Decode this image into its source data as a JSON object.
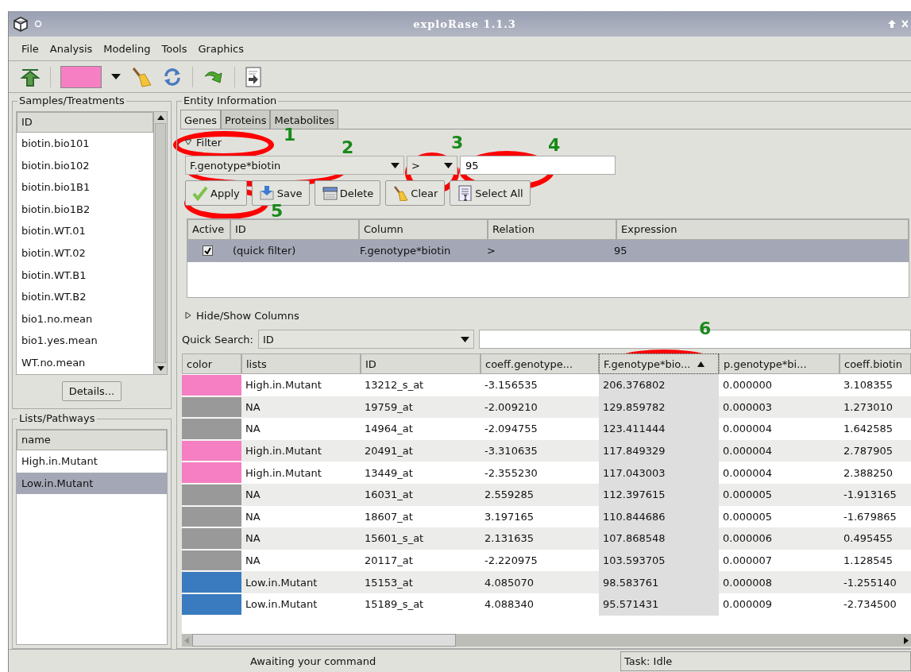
{
  "window": {
    "title": "exploRase 1.1.3"
  },
  "menu": [
    "File",
    "Analysis",
    "Modeling",
    "Tools",
    "Graphics"
  ],
  "samples": {
    "title": "Samples/Treatments",
    "header": "ID",
    "items": [
      "biotin.bio101",
      "biotin.bio102",
      "biotin.bio1B1",
      "biotin.bio1B2",
      "biotin.WT.01",
      "biotin.WT.02",
      "biotin.WT.B1",
      "biotin.WT.B2",
      "bio1.no.mean",
      "bio1.yes.mean",
      "WT.no.mean"
    ],
    "details_button": "Details..."
  },
  "lists": {
    "title": "Lists/Pathways",
    "header": "name",
    "items": [
      {
        "label": "High.in.Mutant",
        "selected": false
      },
      {
        "label": "Low.in.Mutant",
        "selected": true
      }
    ]
  },
  "entity": {
    "title": "Entity Information",
    "tabs": [
      {
        "label": "Genes",
        "selected": true
      },
      {
        "label": "Proteins",
        "selected": false
      },
      {
        "label": "Metabolites",
        "selected": false
      }
    ],
    "filter": {
      "label": "Filter",
      "expanded": true,
      "column": "F.genotype*biotin",
      "relation": ">",
      "value": "95",
      "buttons": [
        {
          "kind": "apply",
          "label": "Apply"
        },
        {
          "kind": "save",
          "label": "Save"
        },
        {
          "kind": "delete",
          "label": "Delete"
        },
        {
          "kind": "clear",
          "label": "Clear"
        },
        {
          "kind": "select_all",
          "label": "Select All"
        }
      ],
      "active_column": "Active",
      "columns": [
        "ID",
        "Column",
        "Relation",
        "Expression"
      ],
      "rows": [
        {
          "active": true,
          "selected": true,
          "cells": [
            "(quick filter)",
            "F.genotype*biotin",
            ">",
            "95"
          ]
        }
      ]
    },
    "hide_show": {
      "label": "Hide/Show Columns",
      "expanded": false
    },
    "quick_search": {
      "label": "Quick Search:",
      "column": "ID"
    },
    "table": {
      "color_column": "color",
      "columns": [
        {
          "label": "lists",
          "sorted": false
        },
        {
          "label": "ID",
          "sorted": false
        },
        {
          "label": "coeff.genotype...",
          "sorted": false
        },
        {
          "label": "F.genotype*bio...",
          "sorted": true
        },
        {
          "label": "p.genotype*bi...",
          "sorted": false
        },
        {
          "label": "coeff.biotin",
          "sorted": false
        }
      ],
      "rows": [
        {
          "color": "#f57fc2",
          "cells": [
            "High.in.Mutant",
            "13212_s_at",
            "-3.156535",
            "206.376802",
            "0.000000",
            "3.108355"
          ]
        },
        {
          "color": "#999999",
          "cells": [
            "NA",
            "19759_at",
            "-2.009210",
            "129.859782",
            "0.000003",
            "1.273010"
          ]
        },
        {
          "color": "#999999",
          "cells": [
            "NA",
            "14964_at",
            "-2.094755",
            "123.411444",
            "0.000004",
            "1.642585"
          ]
        },
        {
          "color": "#f57fc2",
          "cells": [
            "High.in.Mutant",
            "20491_at",
            "-3.310635",
            "117.849329",
            "0.000004",
            "2.787905"
          ]
        },
        {
          "color": "#f57fc2",
          "cells": [
            "High.in.Mutant",
            "13449_at",
            "-2.355230",
            "117.043003",
            "0.000004",
            "2.388250"
          ]
        },
        {
          "color": "#999999",
          "cells": [
            "NA",
            "16031_at",
            "2.559285",
            "112.397615",
            "0.000005",
            "-1.913165"
          ]
        },
        {
          "color": "#999999",
          "cells": [
            "NA",
            "18607_at",
            "3.197165",
            "110.844686",
            "0.000005",
            "-1.679865"
          ]
        },
        {
          "color": "#999999",
          "cells": [
            "NA",
            "15601_s_at",
            "2.131635",
            "107.868548",
            "0.000006",
            "0.495455"
          ]
        },
        {
          "color": "#999999",
          "cells": [
            "NA",
            "20117_at",
            "-2.220975",
            "103.593705",
            "0.000007",
            "1.128545"
          ]
        },
        {
          "color": "#3a7bbf",
          "cells": [
            "Low.in.Mutant",
            "15153_at",
            "4.085070",
            "98.583761",
            "0.000008",
            "-1.255140"
          ]
        },
        {
          "color": "#3a7bbf",
          "cells": [
            "Low.in.Mutant",
            "15189_s_at",
            "4.088340",
            "95.571431",
            "0.000009",
            "-2.734500"
          ]
        }
      ]
    }
  },
  "status_bar": {
    "message": "Awaiting your command",
    "task": "Task: Idle"
  },
  "annotations": [
    "1",
    "2",
    "3",
    "4",
    "5",
    "6"
  ]
}
